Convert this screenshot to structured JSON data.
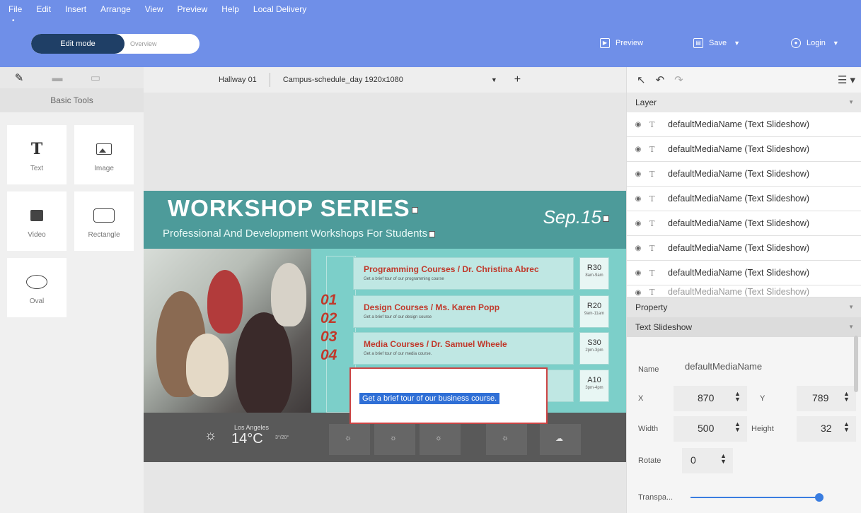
{
  "menu": [
    "File",
    "Edit",
    "Insert",
    "Arrange",
    "View",
    "Preview",
    "Help",
    "Local Delivery"
  ],
  "mode": {
    "active": "Edit mode",
    "inactive": "Overview"
  },
  "top_actions": {
    "preview": "Preview",
    "save": "Save",
    "login": "Login"
  },
  "left_panel": {
    "section_label": "Basic Tools",
    "tools": [
      {
        "label": "Text",
        "icon": "text-icon"
      },
      {
        "label": "Image",
        "icon": "image-icon"
      },
      {
        "label": "Video",
        "icon": "video-icon"
      },
      {
        "label": "Rectangle",
        "icon": "rectangle-icon"
      },
      {
        "label": "Oval",
        "icon": "oval-icon"
      }
    ]
  },
  "canvas_toolbar": {
    "screen": "Hallway 01",
    "file": "Campus-schedule_day 1920x1080"
  },
  "slide": {
    "title": "WORKSHOP SERIES",
    "subtitle": "Professional And Development Workshops For Students",
    "date": "Sep.15",
    "numbers": [
      "01",
      "02",
      "03",
      "04"
    ],
    "courses": [
      {
        "name": "Programming Courses / Dr. Christina Abrec",
        "desc": "Get a brief tour of our programming course",
        "room": "R30",
        "time": "8am-9am"
      },
      {
        "name": "Design Courses / Ms. Karen Popp",
        "desc": "Get a brief tour of our design course",
        "room": "R20",
        "time": "9am-11am"
      },
      {
        "name": "Media Courses / Dr. Samuel Wheele",
        "desc": "Get a brief tour of our media course.",
        "room": "S30",
        "time": "2pm-3pm"
      },
      {
        "name": "",
        "desc": "",
        "room": "A10",
        "time": "3pm-4pm"
      }
    ],
    "weather": {
      "city": "Los Angeles",
      "temp": "14°C",
      "range": "3°/20°"
    },
    "selected_text": "Get a brief tour of our business course."
  },
  "right_panel": {
    "layer_title": "Layer",
    "layers": [
      "defaultMediaName (Text Slideshow)",
      "defaultMediaName (Text Slideshow)",
      "defaultMediaName (Text Slideshow)",
      "defaultMediaName (Text Slideshow)",
      "defaultMediaName (Text Slideshow)",
      "defaultMediaName (Text Slideshow)",
      "defaultMediaName (Text Slideshow)",
      "defaultMediaName (Text Slideshow)"
    ],
    "property_title": "Property",
    "sub_title": "Text Slideshow",
    "fields": {
      "name_label": "Name",
      "name_value": "defaultMediaName",
      "x_label": "X",
      "x_value": "870",
      "y_label": "Y",
      "y_value": "789",
      "width_label": "Width",
      "width_value": "500",
      "height_label": "Height",
      "height_value": "32",
      "rotate_label": "Rotate",
      "rotate_value": "0",
      "transparency_label": "Transpa..."
    },
    "transparency_level": 1.0
  }
}
